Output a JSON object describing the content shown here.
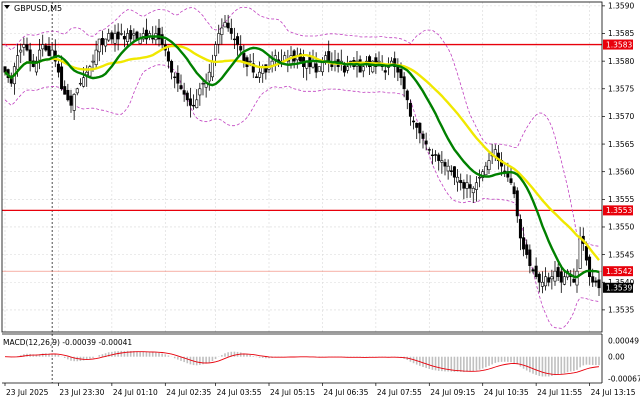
{
  "chart_data": {
    "type": "candlestick",
    "symbol_label": "GBPUSD,M5",
    "price_axis": {
      "ylim": [
        1.3531,
        1.35907
      ],
      "ticks": [
        "1.3590",
        "1.3585",
        "1.3580",
        "1.3575",
        "1.3570",
        "1.3565",
        "1.3560",
        "1.3555",
        "1.3550",
        "1.3545",
        "1.3540",
        "1.3535"
      ],
      "tick_values": [
        1.359,
        1.3585,
        1.358,
        1.3575,
        1.357,
        1.3565,
        1.356,
        1.3555,
        1.355,
        1.3545,
        1.354,
        1.3535
      ]
    },
    "time_axis": {
      "labels": [
        "23 Jul 2025",
        "23 Jul 23:30",
        "24 Jul 01:10",
        "24 Jul 02:35",
        "24 Jul 03:55",
        "24 Jul 05:15",
        "24 Jul 06:35",
        "24 Jul 07:55",
        "24 Jul 09:15",
        "24 Jul 10:35",
        "24 Jul 11:55",
        "24 Jul 13:15"
      ],
      "bar_index": [
        0,
        17,
        34,
        51,
        67,
        84,
        101,
        118,
        135,
        152,
        169,
        186
      ]
    },
    "bar_count": 190,
    "closes": [
      1.3578,
      1.3577,
      1.3576,
      1.3579,
      1.3581,
      1.3582,
      1.3583,
      1.3582,
      1.358,
      1.3579,
      1.358,
      1.3582,
      1.3583,
      1.3582,
      1.3581,
      1.3582,
      1.358,
      1.3578,
      1.3575,
      1.3574,
      1.3573,
      1.3572,
      1.3574,
      1.3575,
      1.3576,
      1.3577,
      1.3578,
      1.3579,
      1.358,
      1.3582,
      1.3584,
      1.3583,
      1.3584,
      1.3585,
      1.3584,
      1.3585,
      1.3584,
      1.3585,
      1.3584,
      1.3585,
      1.3584,
      1.3585,
      1.3584,
      1.3584,
      1.3585,
      1.3584,
      1.3585,
      1.3584,
      1.3585,
      1.3584,
      1.3583,
      1.3582,
      1.358,
      1.3578,
      1.3577,
      1.3576,
      1.3575,
      1.3574,
      1.3573,
      1.3572,
      1.3572,
      1.3573,
      1.3575,
      1.3576,
      1.3576,
      1.3578,
      1.358,
      1.3583,
      1.3585,
      1.3586,
      1.3587,
      1.3586,
      1.3585,
      1.3584,
      1.3583,
      1.3582,
      1.358,
      1.3579,
      1.358,
      1.3578,
      1.3577,
      1.3578,
      1.3579,
      1.3578,
      1.3579,
      1.358,
      1.3581,
      1.358,
      1.358,
      1.3581,
      1.358,
      1.3581,
      1.358,
      1.3581,
      1.358,
      1.3579,
      1.358,
      1.3579,
      1.358,
      1.3578,
      1.3579,
      1.358,
      1.3581,
      1.358,
      1.3579,
      1.358,
      1.3579,
      1.358,
      1.3578,
      1.3579,
      1.358,
      1.3579,
      1.358,
      1.3578,
      1.3579,
      1.358,
      1.3579,
      1.358,
      1.3579,
      1.358,
      1.3579,
      1.3578,
      1.3579,
      1.358,
      1.3579,
      1.3578,
      1.3577,
      1.3575,
      1.3573,
      1.357,
      1.3569,
      1.3568,
      1.3567,
      1.3566,
      1.3565,
      1.3564,
      1.3563,
      1.3563,
      1.3562,
      1.3562,
      1.3561,
      1.3561,
      1.356,
      1.3559,
      1.3559,
      1.3558,
      1.3557,
      1.3558,
      1.3557,
      1.3557,
      1.3558,
      1.3559,
      1.356,
      1.3561,
      1.3562,
      1.3563,
      1.3564,
      1.3562,
      1.3561,
      1.356,
      1.3559,
      1.3558,
      1.3556,
      1.3552,
      1.3548,
      1.3546,
      1.3545,
      1.3543,
      1.3542,
      1.3541,
      1.354,
      1.354,
      1.3541,
      1.354,
      1.3541,
      1.3542,
      1.3541,
      1.354,
      1.3541,
      1.3542,
      1.3541,
      1.354,
      1.3542,
      1.3548,
      1.3547,
      1.3544,
      1.3541,
      1.354,
      1.354,
      1.3539
    ],
    "levels": [
      {
        "value": 1.3583,
        "label": "1.3583",
        "color": "#e8000b",
        "style": "line"
      },
      {
        "value": 1.3553,
        "label": "1.3553",
        "color": "#e8000b",
        "style": "line"
      },
      {
        "value": 1.3542,
        "label": "1.3542",
        "color": "#f08070",
        "style": "thin"
      }
    ],
    "current_price": {
      "value": 1.3539,
      "label": "1.3539"
    },
    "moving_averages": [
      {
        "period": 30,
        "color": "#f0e800"
      },
      {
        "period": 15,
        "color": "#008000"
      }
    ],
    "bollinger_color": "#c040c0",
    "candle_color": "#000000",
    "macd": {
      "label": "MACD(12,26,9) -0.00039 -0.00041",
      "ticks": [
        "0.00049",
        "0.00",
        "-0.00067"
      ],
      "tick_values": [
        0.00049,
        0.0,
        -0.00067
      ],
      "ylim": [
        -0.0008,
        0.0006
      ],
      "signal_color": "#e8000b",
      "histogram_color": "#c0c0c0"
    },
    "colors": {
      "background": "#ffffff",
      "grid": "#d8d8d8",
      "axis": "#000000",
      "tag_black": "#000000"
    }
  }
}
